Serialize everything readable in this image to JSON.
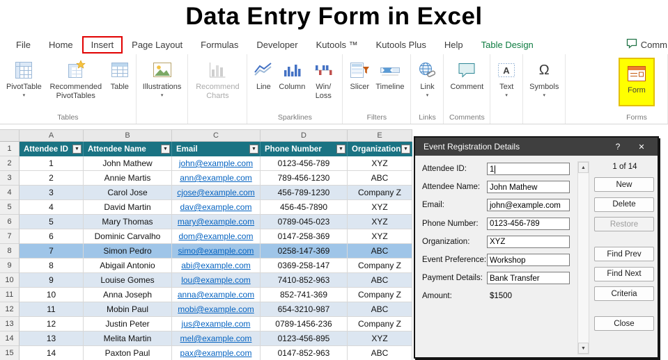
{
  "banner": {
    "title": "Data Entry Form in Excel"
  },
  "ribbon": {
    "tabs": [
      {
        "label": "File",
        "style": "normal"
      },
      {
        "label": "Home",
        "style": "normal"
      },
      {
        "label": "Insert",
        "style": "boxed"
      },
      {
        "label": "Page Layout",
        "style": "normal"
      },
      {
        "label": "Formulas",
        "style": "normal"
      },
      {
        "label": "Developer",
        "style": "normal"
      },
      {
        "label": "Kutools ™",
        "style": "normal"
      },
      {
        "label": "Kutools Plus",
        "style": "normal"
      },
      {
        "label": "Help",
        "style": "normal"
      },
      {
        "label": "Table Design",
        "style": "green"
      }
    ],
    "comments_button": "Comm",
    "buttons": {
      "pivottable": "PivotTable",
      "recommended_pivottables": "Recommended PivotTables",
      "table": "Table",
      "illustrations": "Illustrations",
      "recommended_charts": "Recommend Charts",
      "line": "Line",
      "column": "Column",
      "win_loss": "Win/ Loss",
      "slicer": "Slicer",
      "timeline": "Timeline",
      "link": "Link",
      "comment": "Comment",
      "text": "Text",
      "symbols": "Symbols",
      "form": "Form"
    },
    "group_labels": {
      "tables": "Tables",
      "sparklines": "Sparklines",
      "filters": "Filters",
      "links": "Links",
      "comments": "Comments",
      "forms": "Forms"
    }
  },
  "sheet": {
    "column_letters": [
      "A",
      "B",
      "C",
      "D",
      "E"
    ],
    "header_row": {
      "number": "1",
      "cells": [
        "Attendee ID",
        "Attendee Name",
        "Email",
        "Phone Number",
        "Organization"
      ]
    },
    "rows": [
      {
        "number": "2",
        "id": "1",
        "name": "John Mathew",
        "email": "john@example.com",
        "phone": "0123-456-789",
        "org": "XYZ",
        "shade": "plain"
      },
      {
        "number": "3",
        "id": "2",
        "name": "Annie Martis",
        "email": "ann@example.com",
        "phone": "789-456-1230",
        "org": "ABC",
        "shade": "plain"
      },
      {
        "number": "4",
        "id": "3",
        "name": "Carol Jose",
        "email": "cjose@example.com",
        "phone": "456-789-1230",
        "org": "Company Z",
        "shade": "band"
      },
      {
        "number": "5",
        "id": "4",
        "name": "David Martin",
        "email": "dav@example.com",
        "phone": "456-45-7890",
        "org": "XYZ",
        "shade": "plain"
      },
      {
        "number": "6",
        "id": "5",
        "name": "Mary Thomas",
        "email": "mary@example.com",
        "phone": "0789-045-023",
        "org": "XYZ",
        "shade": "band"
      },
      {
        "number": "7",
        "id": "6",
        "name": "Dominic Carvalho",
        "email": "dom@example.com",
        "phone": "0147-258-369",
        "org": "XYZ",
        "shade": "plain"
      },
      {
        "number": "8",
        "id": "7",
        "name": "Simon Pedro",
        "email": "simo@example.com",
        "phone": "0258-147-369",
        "org": "ABC",
        "shade": "selected"
      },
      {
        "number": "9",
        "id": "8",
        "name": "Abigail Antonio",
        "email": "abi@example.com",
        "phone": "0369-258-147",
        "org": "Company Z",
        "shade": "plain"
      },
      {
        "number": "10",
        "id": "9",
        "name": "Louise Gomes",
        "email": "lou@example.com",
        "phone": "7410-852-963",
        "org": "ABC",
        "shade": "band"
      },
      {
        "number": "11",
        "id": "10",
        "name": "Anna Joseph",
        "email": "anna@example.com",
        "phone": "852-741-369",
        "org": "Company Z",
        "shade": "plain"
      },
      {
        "number": "12",
        "id": "11",
        "name": "Mobin Paul",
        "email": "mobi@example.com",
        "phone": "654-3210-987",
        "org": "ABC",
        "shade": "band"
      },
      {
        "number": "13",
        "id": "12",
        "name": "Justin Peter",
        "email": "jus@example.com",
        "phone": "0789-1456-236",
        "org": "Company Z",
        "shade": "plain"
      },
      {
        "number": "14",
        "id": "13",
        "name": "Melita Martin",
        "email": "mel@example.com",
        "phone": "0123-456-895",
        "org": "XYZ",
        "shade": "band"
      },
      {
        "number": "15",
        "id": "14",
        "name": "Paxton Paul",
        "email": "pax@example.com",
        "phone": "0147-852-963",
        "org": "ABC",
        "shade": "plain"
      }
    ]
  },
  "dialog": {
    "title": "Event Registration Details",
    "help_glyph": "?",
    "close_glyph": "✕",
    "record_indicator": "1 of 14",
    "fields": [
      {
        "label": "Attendee ID:",
        "value": "1",
        "boxed": true
      },
      {
        "label": "Attendee Name:",
        "value": "John Mathew",
        "boxed": true
      },
      {
        "label": "Email:",
        "value": "john@example.com",
        "boxed": true
      },
      {
        "label": "Phone Number:",
        "value": "0123-456-789",
        "boxed": true
      },
      {
        "label": "Organization:",
        "value": "XYZ",
        "boxed": true
      },
      {
        "label": "Event Preference:",
        "value": "Workshop",
        "boxed": true
      },
      {
        "label": "Payment Details:",
        "value": "Bank Transfer",
        "boxed": true
      },
      {
        "label": "Amount:",
        "value": "$1500",
        "boxed": false
      }
    ],
    "buttons": [
      {
        "label": "New",
        "enabled": true,
        "gap": false
      },
      {
        "label": "Delete",
        "enabled": true,
        "gap": false
      },
      {
        "label": "Restore",
        "enabled": false,
        "gap": true
      },
      {
        "label": "Find Prev",
        "enabled": true,
        "gap": false
      },
      {
        "label": "Find Next",
        "enabled": true,
        "gap": false
      },
      {
        "label": "Criteria",
        "enabled": true,
        "gap": true
      },
      {
        "label": "Close",
        "enabled": true,
        "gap": false
      }
    ]
  },
  "icons": {
    "symbols_glyph": "Ω",
    "dropdown_caret": "▾",
    "filter_caret": "▼",
    "scroll_up": "▲",
    "scroll_down": "▼"
  },
  "colors": {
    "header_teal": "#1A7383",
    "band_blue": "#DCE6F1",
    "selected_blue": "#9FC5E8",
    "link_blue": "#0563C1",
    "tab_green": "#0E7C41",
    "highlight_red": "#E10000",
    "form_yellow": "#FFFF00",
    "arrow_green": "#00713F"
  }
}
